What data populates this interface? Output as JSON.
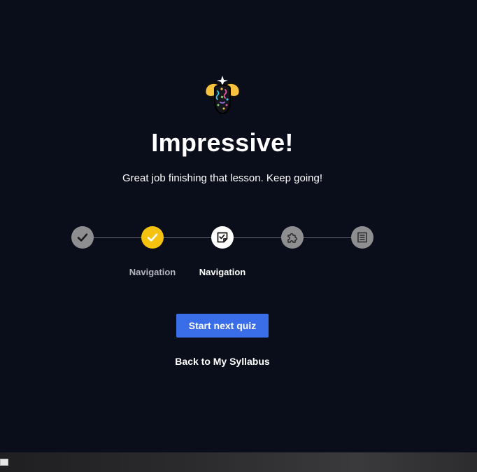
{
  "celebration": {
    "icon": "firefly-confetti-icon",
    "headline": "Impressive!",
    "subtitle": "Great job finishing that lesson. Keep going!"
  },
  "progress": {
    "steps": [
      {
        "state": "completed",
        "icon": "checkmark-icon",
        "label": ""
      },
      {
        "state": "current-completed",
        "icon": "checkmark-icon",
        "label": "Navigation"
      },
      {
        "state": "next",
        "icon": "quiz-icon",
        "label": "Navigation"
      },
      {
        "state": "locked",
        "icon": "puzzle-icon",
        "label": ""
      },
      {
        "state": "locked",
        "icon": "article-icon",
        "label": ""
      }
    ]
  },
  "actions": {
    "primary_label": "Start next quiz",
    "secondary_label": "Back to My Syllabus"
  },
  "colors": {
    "background": "#0a0d1a",
    "accent_yellow": "#f4c20f",
    "primary_button": "#3a6ee8",
    "step_gray": "#8e8e91",
    "track_line": "#5d606b"
  }
}
